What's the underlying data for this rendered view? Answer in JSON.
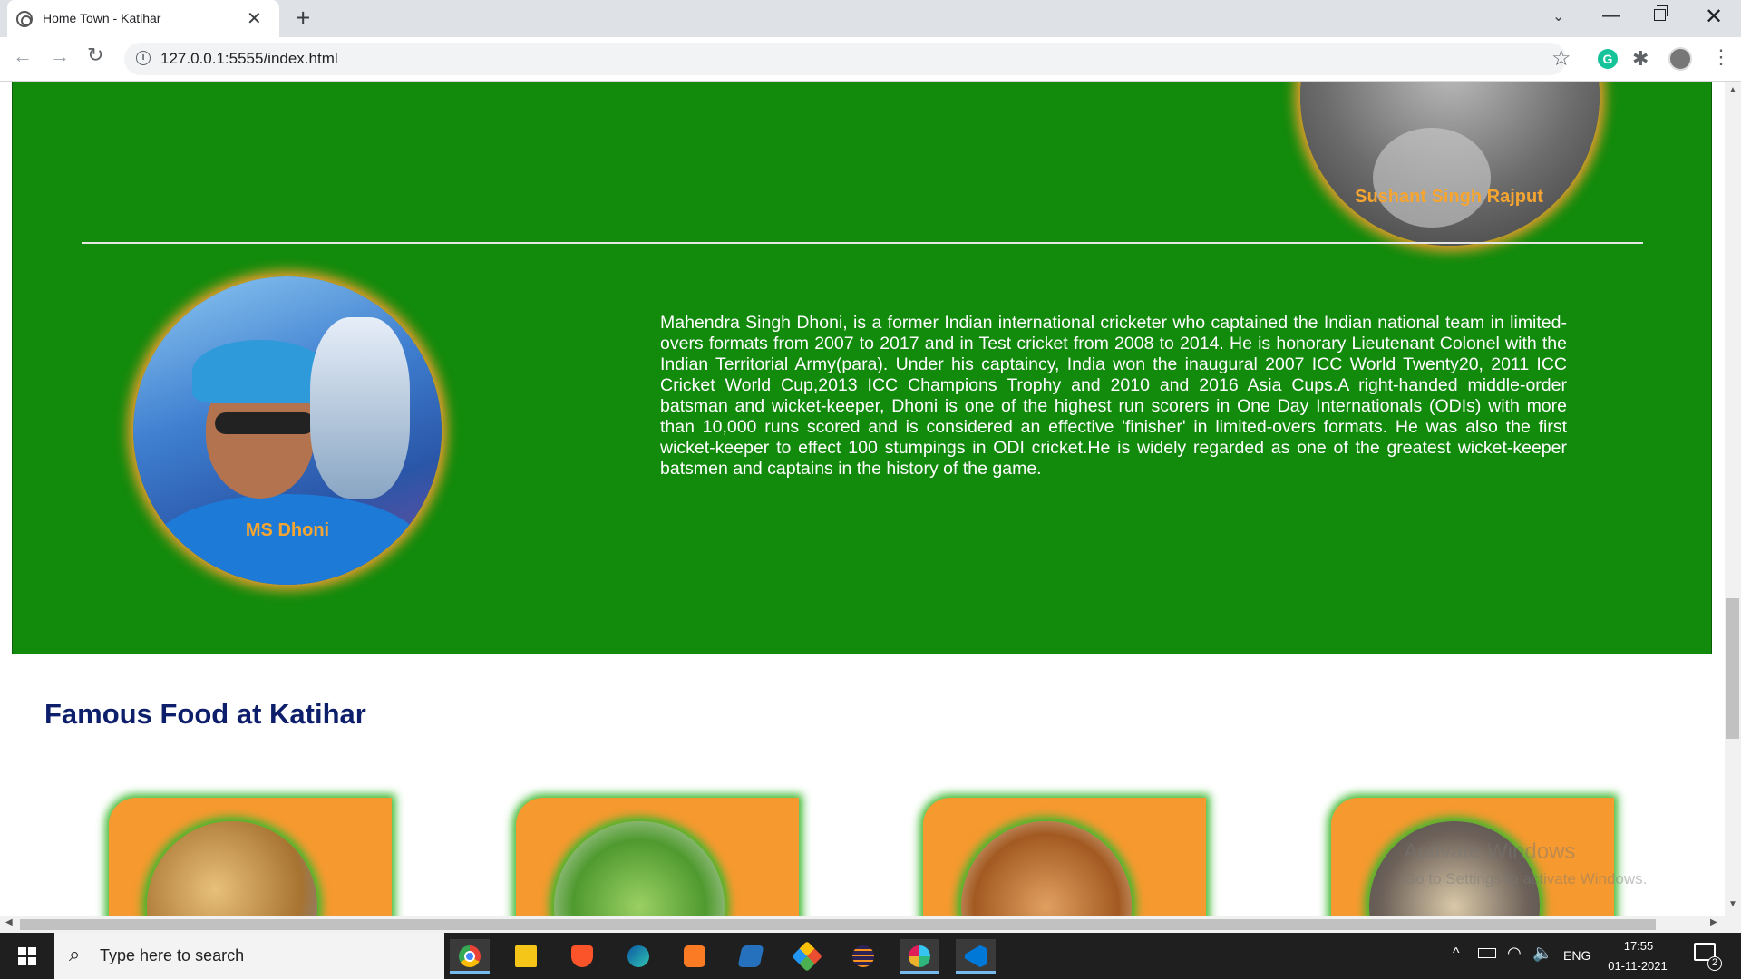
{
  "browser": {
    "tab_title": "Home Town - Katihar",
    "url": "127.0.0.1:5555/index.html"
  },
  "page": {
    "people": [
      {
        "name": "Sushant Singh Rajput"
      },
      {
        "name": "MS Dhoni",
        "bio": "Mahendra Singh Dhoni, is a former Indian international cricketer who captained the Indian national team in limited-overs formats from 2007 to 2017 and in Test cricket from 2008 to 2014. He is honorary Lieutenant Colonel with the Indian Territorial Army(para). Under his captaincy, India won the inaugural 2007 ICC World Twenty20, 2011 ICC Cricket World Cup,2013 ICC Champions Trophy and 2010 and 2016 Asia Cups.A right-handed middle-order batsman and wicket-keeper, Dhoni is one of the highest run scorers in One Day Internationals (ODIs) with more than 10,000 runs scored and is considered an effective 'finisher' in limited-overs formats. He was also the first wicket-keeper to effect 100 stumpings in ODI cricket.He is widely regarded as one of the greatest wicket-keeper batsmen and captains in the history of the game."
      }
    ],
    "food_heading": "Famous Food at Katihar",
    "colors": {
      "section_green": "#128a0c",
      "name_orange": "#f5a530",
      "card_orange": "#f6992f",
      "heading_navy": "#0d1f6b"
    }
  },
  "watermark": {
    "line1": "Activate Windows",
    "line2": "Go to Settings to activate Windows."
  },
  "taskbar": {
    "search_placeholder": "Type here to search",
    "apps": [
      "chrome-icon",
      "file-explorer-icon",
      "brave-icon",
      "edge-icon",
      "xampp-icon",
      "powershell-icon",
      "git-icon",
      "eclipse-icon",
      "slack-icon",
      "vscode-icon"
    ],
    "language": "ENG",
    "time": "17:55",
    "date": "01-11-2021",
    "notification_count": "2"
  }
}
